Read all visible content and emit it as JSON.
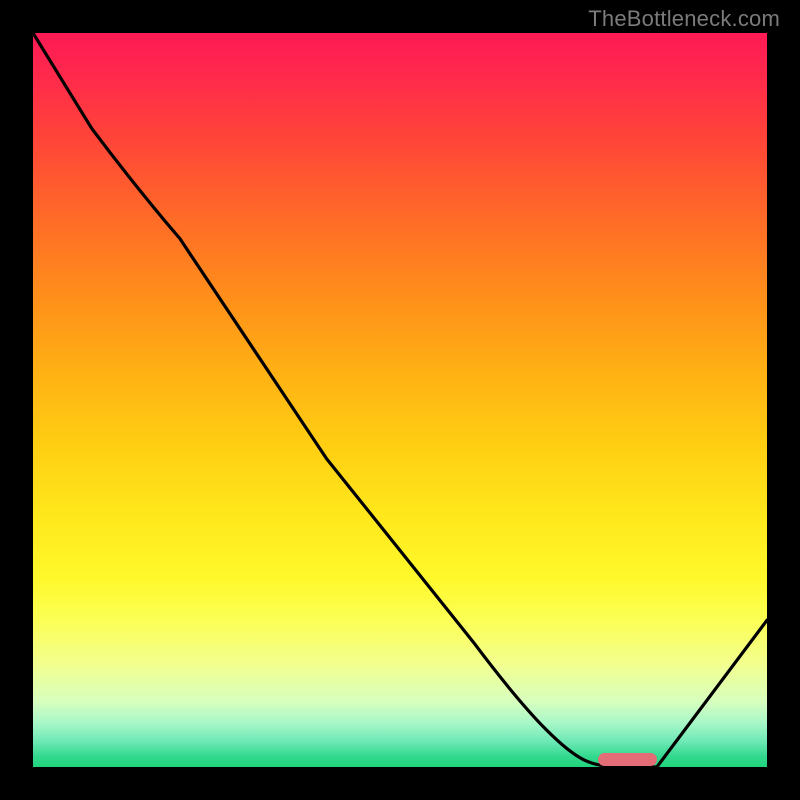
{
  "watermark": "TheBottleneck.com",
  "colors": {
    "frame_bg": "#000000",
    "curve_stroke": "#000000",
    "pill_fill": "#e26d76",
    "watermark_fg": "#7b7b7b"
  },
  "chart_data": {
    "type": "line",
    "title": "",
    "xlabel": "",
    "ylabel": "",
    "xlim": [
      0,
      100
    ],
    "ylim": [
      0,
      100
    ],
    "x": [
      0,
      8,
      20,
      40,
      60,
      70,
      75,
      80,
      85,
      100
    ],
    "values": [
      100,
      87,
      72,
      42,
      17,
      5,
      1,
      0,
      0,
      20
    ],
    "optimum_marker": {
      "x_range": [
        77,
        85
      ],
      "y": 0
    },
    "notes": "Axes are unlabeled; values are read off relative to the plot frame (0-100 in each direction). Curve descends from top-left, reaches ~0 near x≈77-85, then rises toward x=100."
  }
}
